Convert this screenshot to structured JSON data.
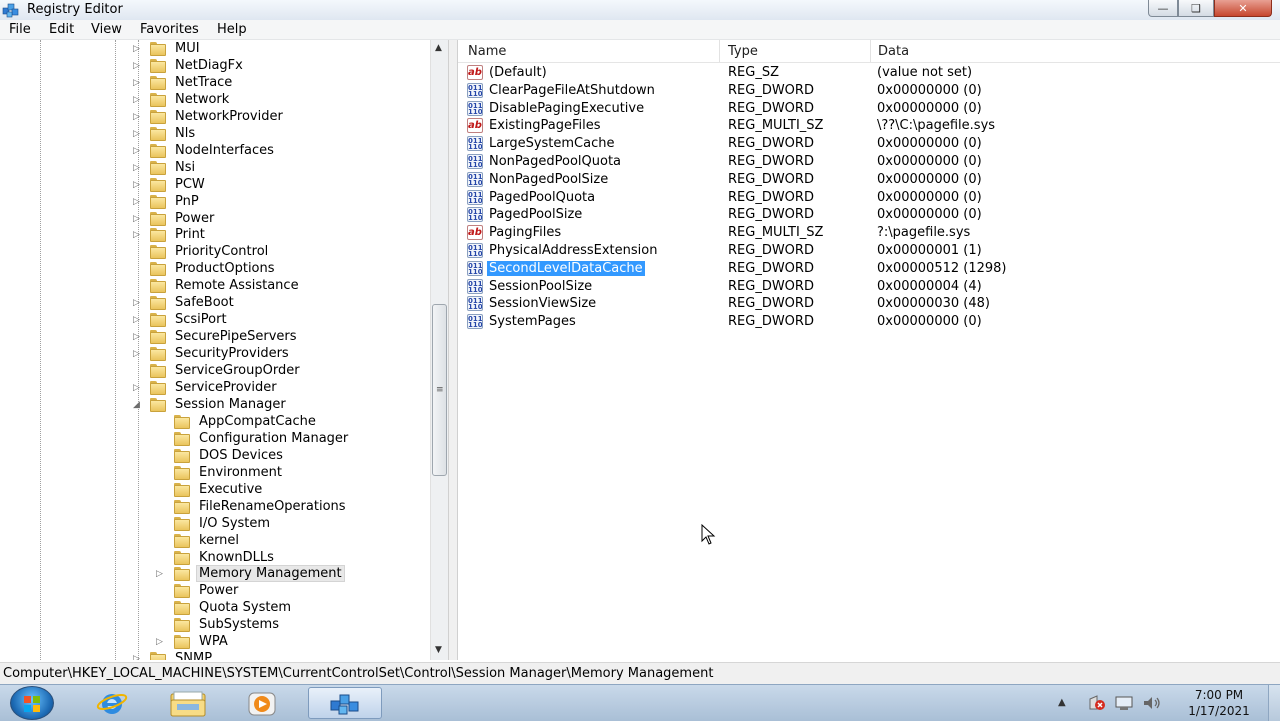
{
  "window": {
    "title": "Registry Editor"
  },
  "menu": [
    "File",
    "Edit",
    "View",
    "Favorites",
    "Help"
  ],
  "tree": {
    "items": [
      {
        "label": "MUI",
        "level": 1,
        "expander": "collapsed"
      },
      {
        "label": "NetDiagFx",
        "level": 1,
        "expander": "collapsed"
      },
      {
        "label": "NetTrace",
        "level": 1,
        "expander": "collapsed"
      },
      {
        "label": "Network",
        "level": 1,
        "expander": "collapsed"
      },
      {
        "label": "NetworkProvider",
        "level": 1,
        "expander": "collapsed"
      },
      {
        "label": "Nls",
        "level": 1,
        "expander": "collapsed"
      },
      {
        "label": "NodeInterfaces",
        "level": 1,
        "expander": "collapsed"
      },
      {
        "label": "Nsi",
        "level": 1,
        "expander": "collapsed"
      },
      {
        "label": "PCW",
        "level": 1,
        "expander": "collapsed"
      },
      {
        "label": "PnP",
        "level": 1,
        "expander": "collapsed"
      },
      {
        "label": "Power",
        "level": 1,
        "expander": "collapsed"
      },
      {
        "label": "Print",
        "level": 1,
        "expander": "collapsed"
      },
      {
        "label": "PriorityControl",
        "level": 1,
        "expander": "none"
      },
      {
        "label": "ProductOptions",
        "level": 1,
        "expander": "none"
      },
      {
        "label": "Remote Assistance",
        "level": 1,
        "expander": "none"
      },
      {
        "label": "SafeBoot",
        "level": 1,
        "expander": "collapsed"
      },
      {
        "label": "ScsiPort",
        "level": 1,
        "expander": "collapsed"
      },
      {
        "label": "SecurePipeServers",
        "level": 1,
        "expander": "collapsed"
      },
      {
        "label": "SecurityProviders",
        "level": 1,
        "expander": "collapsed"
      },
      {
        "label": "ServiceGroupOrder",
        "level": 1,
        "expander": "none"
      },
      {
        "label": "ServiceProvider",
        "level": 1,
        "expander": "collapsed"
      },
      {
        "label": "Session Manager",
        "level": 1,
        "expander": "expanded"
      },
      {
        "label": "AppCompatCache",
        "level": 2,
        "expander": "none"
      },
      {
        "label": "Configuration Manager",
        "level": 2,
        "expander": "none"
      },
      {
        "label": "DOS Devices",
        "level": 2,
        "expander": "none"
      },
      {
        "label": "Environment",
        "level": 2,
        "expander": "none"
      },
      {
        "label": "Executive",
        "level": 2,
        "expander": "none"
      },
      {
        "label": "FileRenameOperations",
        "level": 2,
        "expander": "none"
      },
      {
        "label": "I/O System",
        "level": 2,
        "expander": "none"
      },
      {
        "label": "kernel",
        "level": 2,
        "expander": "none"
      },
      {
        "label": "KnownDLLs",
        "level": 2,
        "expander": "none"
      },
      {
        "label": "Memory Management",
        "level": 2,
        "expander": "collapsed",
        "selected": true
      },
      {
        "label": "Power",
        "level": 2,
        "expander": "none"
      },
      {
        "label": "Quota System",
        "level": 2,
        "expander": "none"
      },
      {
        "label": "SubSystems",
        "level": 2,
        "expander": "none"
      },
      {
        "label": "WPA",
        "level": 2,
        "expander": "collapsed"
      },
      {
        "label": "SNMP",
        "level": 1,
        "expander": "collapsed"
      }
    ]
  },
  "list": {
    "columns": [
      "Name",
      "Type",
      "Data"
    ],
    "rows": [
      {
        "icon": "ab",
        "name": "(Default)",
        "type": "REG_SZ",
        "data": "(value not set)"
      },
      {
        "icon": "bin",
        "name": "ClearPageFileAtShutdown",
        "type": "REG_DWORD",
        "data": "0x00000000 (0)"
      },
      {
        "icon": "bin",
        "name": "DisablePagingExecutive",
        "type": "REG_DWORD",
        "data": "0x00000000 (0)"
      },
      {
        "icon": "ab",
        "name": "ExistingPageFiles",
        "type": "REG_MULTI_SZ",
        "data": "\\??\\C:\\pagefile.sys"
      },
      {
        "icon": "bin",
        "name": "LargeSystemCache",
        "type": "REG_DWORD",
        "data": "0x00000000 (0)"
      },
      {
        "icon": "bin",
        "name": "NonPagedPoolQuota",
        "type": "REG_DWORD",
        "data": "0x00000000 (0)"
      },
      {
        "icon": "bin",
        "name": "NonPagedPoolSize",
        "type": "REG_DWORD",
        "data": "0x00000000 (0)"
      },
      {
        "icon": "bin",
        "name": "PagedPoolQuota",
        "type": "REG_DWORD",
        "data": "0x00000000 (0)"
      },
      {
        "icon": "bin",
        "name": "PagedPoolSize",
        "type": "REG_DWORD",
        "data": "0x00000000 (0)"
      },
      {
        "icon": "ab",
        "name": "PagingFiles",
        "type": "REG_MULTI_SZ",
        "data": "?:\\pagefile.sys"
      },
      {
        "icon": "bin",
        "name": "PhysicalAddressExtension",
        "type": "REG_DWORD",
        "data": "0x00000001 (1)"
      },
      {
        "icon": "bin",
        "name": "SecondLevelDataCache",
        "type": "REG_DWORD",
        "data": "0x00000512 (1298)",
        "selected": true
      },
      {
        "icon": "bin",
        "name": "SessionPoolSize",
        "type": "REG_DWORD",
        "data": "0x00000004 (4)"
      },
      {
        "icon": "bin",
        "name": "SessionViewSize",
        "type": "REG_DWORD",
        "data": "0x00000030 (48)"
      },
      {
        "icon": "bin",
        "name": "SystemPages",
        "type": "REG_DWORD",
        "data": "0x00000000 (0)"
      }
    ]
  },
  "status": {
    "path": "Computer\\HKEY_LOCAL_MACHINE\\SYSTEM\\CurrentControlSet\\Control\\Session Manager\\Memory Management"
  },
  "taskbar": {
    "apps": [
      "internet-explorer-icon",
      "windows-explorer-icon",
      "media-player-icon",
      "registry-editor-icon"
    ],
    "clock_time": "7:00 PM",
    "clock_date": "1/17/2021"
  },
  "colors": {
    "selection": "#3399ff",
    "titlebar": "#dfe7f1",
    "taskbar": "#b9cde2"
  }
}
